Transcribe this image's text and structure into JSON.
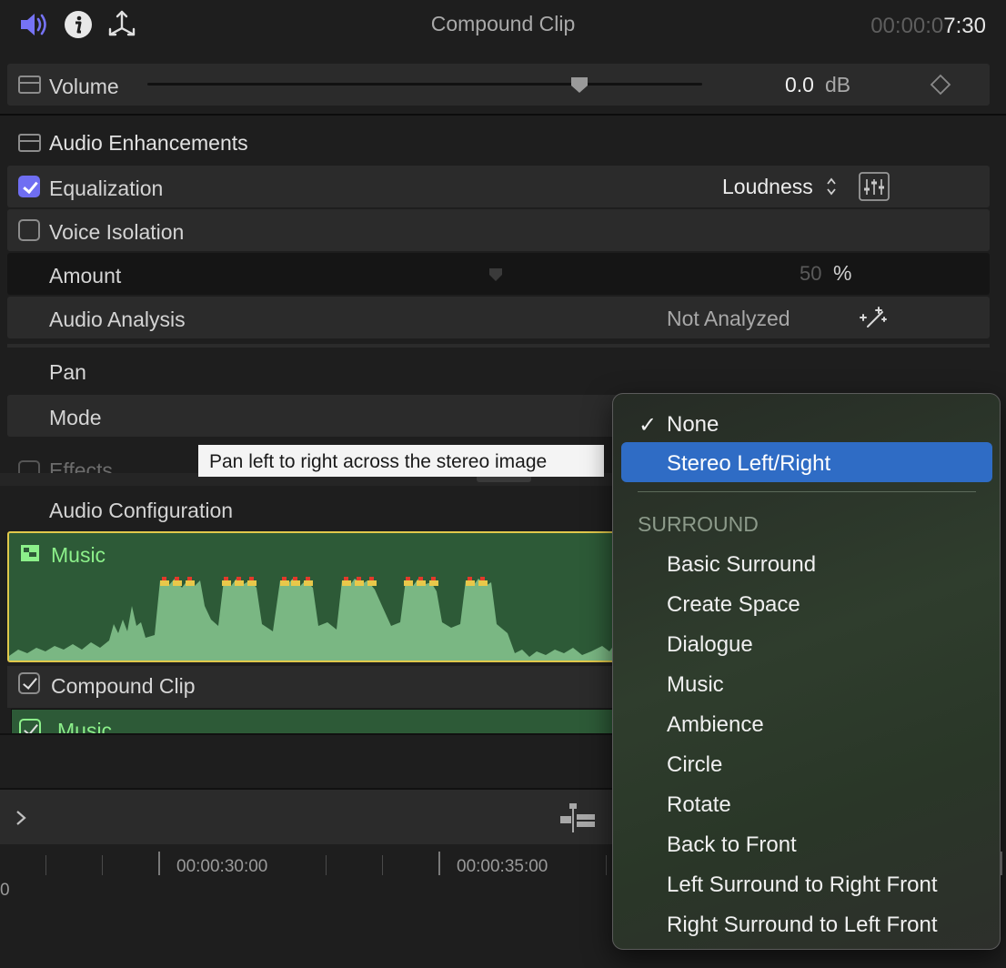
{
  "header": {
    "title": "Compound Clip",
    "timecode_dim": "00:00:0",
    "timecode_bright": "7:30",
    "icons": [
      "speaker-icon",
      "info-icon",
      "transform-icon"
    ]
  },
  "volume": {
    "label": "Volume",
    "value": "0.0",
    "unit": "dB",
    "slider_fraction": 0.78
  },
  "enhancements": {
    "title": "Audio Enhancements",
    "equalization": {
      "label": "Equalization",
      "checked": true,
      "preset": "Loudness"
    },
    "voice_isolation": {
      "label": "Voice Isolation",
      "checked": false
    },
    "amount": {
      "label": "Amount",
      "value": "50",
      "unit": "%"
    },
    "analysis": {
      "label": "Audio Analysis",
      "value": "Not Analyzed"
    }
  },
  "pan": {
    "title": "Pan",
    "mode_label": "Mode"
  },
  "effects_label": "Effects",
  "audio_config": {
    "label": "Audio Configuration",
    "clip_name": "Music",
    "compound_label": "Compound Clip",
    "sub_clip_name": "Music"
  },
  "ruler": {
    "labels": [
      "00:00:30:00",
      "00:00:35:00"
    ],
    "left_fragment": "0"
  },
  "tooltip": "Pan left to right across the stereo image",
  "menu": {
    "checked_item": "None",
    "highlighted_item": "Stereo Left/Right",
    "section_header": "SURROUND",
    "items": [
      "Basic Surround",
      "Create Space",
      "Dialogue",
      "Music",
      "Ambience",
      "Circle",
      "Rotate",
      "Back to Front",
      "Left Surround to Right Front",
      "Right Surround to Left Front"
    ]
  },
  "colors": {
    "accent": "#6f6ef2",
    "highlight": "#2f6cc5",
    "clip_green": "#2d5a37",
    "clip_border": "#e1c84b",
    "clip_text": "#8cf08a"
  }
}
